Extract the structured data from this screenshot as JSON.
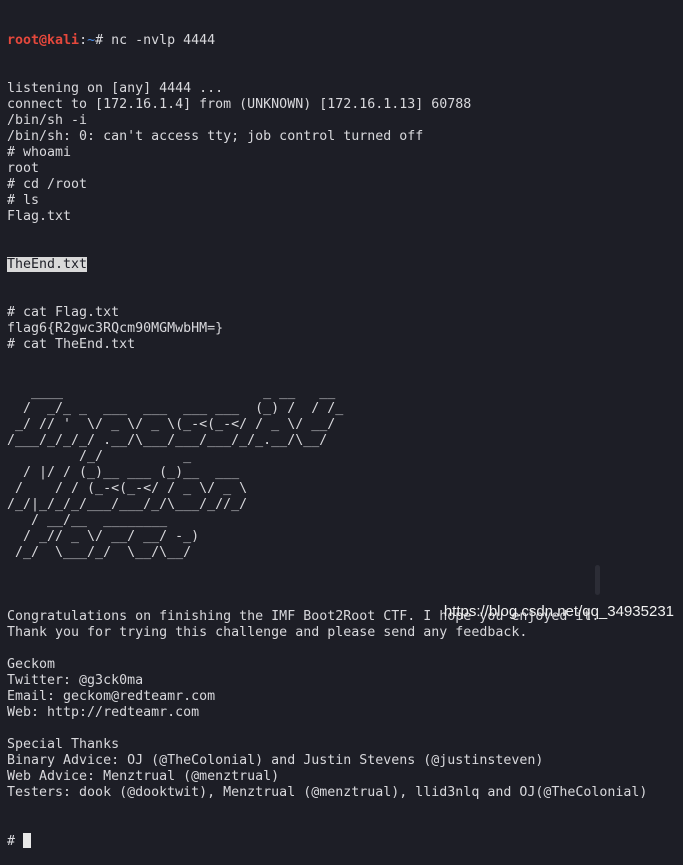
{
  "prompt": {
    "user": "root@kali",
    "sep": ":",
    "path": "~",
    "symbol": "# ",
    "command": "nc -nvlp 4444"
  },
  "output_before": [
    "listening on [any] 4444 ...",
    "connect to [172.16.1.4] from (UNKNOWN) [172.16.1.13] 60788",
    "/bin/sh -i",
    "/bin/sh: 0: can't access tty; job control turned off",
    "# whoami",
    "root",
    "# cd /root",
    "# ls",
    "Flag.txt"
  ],
  "selected_file": "TheEnd.txt",
  "output_mid": [
    "# cat Flag.txt",
    "flag6{R2gwc3RQcm90MGMwbHM=}",
    "# cat TheEnd.txt"
  ],
  "ascii_art": [
    "   ____                         _ __   __",
    "  /  _/_ _  ___  ___  ___ ___  (_) /  / /_",
    " _/ // '  \\/ _ \\/ _ \\(_-<(_-</ / _ \\/ __/",
    "/___/_/_/_/ .__/\\___/___/___/_/_.__/\\__/",
    "         /_/          _",
    "  / |/ / (_)__ ___ (_)__  ___",
    " /    / / (_-<(_-</ / _ \\/ _ \\",
    "/_/|_/_/_/___/___/_/\\___/_//_/",
    "   / __/__  ________",
    "  / _// _ \\/ __/ __/ -_)",
    " /_/  \\___/_/  \\__/\\__/"
  ],
  "output_after": [
    "",
    "Congratulations on finishing the IMF Boot2Root CTF. I hope you enjoyed it.",
    "Thank you for trying this challenge and please send any feedback.",
    "",
    "Geckom",
    "Twitter: @g3ck0ma",
    "Email: geckom@redteamr.com",
    "Web: http://redteamr.com",
    "",
    "Special Thanks",
    "Binary Advice: OJ (@TheColonial) and Justin Stevens (@justinsteven)",
    "Web Advice: Menztrual (@menztrual)",
    "Testers: dook (@dooktwit), Menztrual (@menztrual), llid3nlq and OJ(@TheColonial)"
  ],
  "final_prompt": "# ",
  "watermark": "https://blog.csdn.net/qq_34935231",
  "colors": {
    "background": "#1d1e26",
    "user": "#e5483c",
    "path": "#4d8fe8",
    "text": "#d8d8dc"
  }
}
